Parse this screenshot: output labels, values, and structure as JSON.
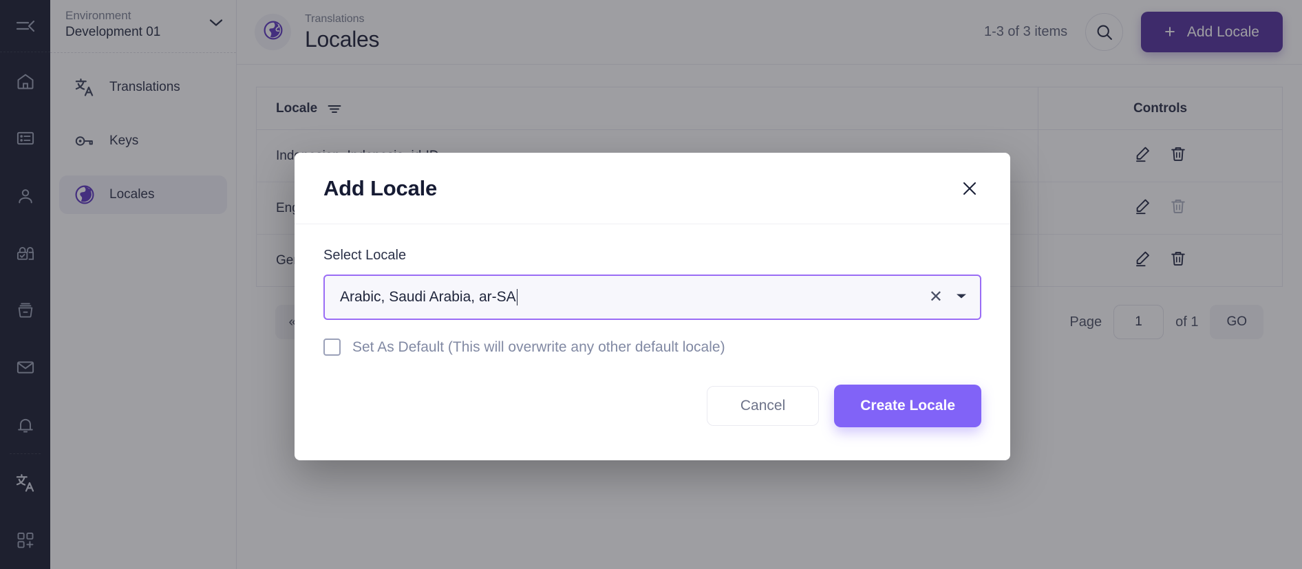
{
  "rail": {
    "collapse_icon": "collapse-menu-icon",
    "items": [
      {
        "icon": "home-icon"
      },
      {
        "icon": "content-list-icon"
      },
      {
        "icon": "user-icon"
      },
      {
        "icon": "security-lock-icon"
      },
      {
        "icon": "archive-icon"
      },
      {
        "icon": "mail-icon"
      },
      {
        "icon": "bell-icon"
      },
      {
        "icon": "translate-icon"
      },
      {
        "icon": "integrations-icon"
      }
    ]
  },
  "sidebar": {
    "env_label": "Environment",
    "env_value": "Development 01",
    "env_caret_icon": "chevron-down-icon",
    "items": [
      {
        "label": "Translations",
        "icon": "translate-icon",
        "active": false
      },
      {
        "label": "Keys",
        "icon": "key-icon",
        "active": false
      },
      {
        "label": "Locales",
        "icon": "globe-icon",
        "active": true
      }
    ]
  },
  "header": {
    "breadcrumb": "Translations",
    "title": "Locales",
    "badge_icon": "globe-icon",
    "items_count": "1-3 of 3 items",
    "search_icon": "search-icon",
    "add_button_label": "Add Locale",
    "add_button_icon": "plus-icon",
    "accent_color": "#512f9b"
  },
  "table": {
    "columns": [
      "Locale",
      "Controls"
    ],
    "filter_icon": "filter-icon",
    "rows": [
      {
        "locale": "Indonesian, Indonesia, id-ID",
        "edit_icon": "pencil-icon",
        "delete_icon": "trash-icon",
        "delete_disabled": false
      },
      {
        "locale": "English, United States, en-US",
        "edit_icon": "pencil-icon",
        "delete_icon": "trash-icon",
        "delete_disabled": true
      },
      {
        "locale": "German, Germany, de-DE",
        "edit_icon": "pencil-icon",
        "delete_icon": "trash-icon",
        "delete_disabled": false
      }
    ]
  },
  "pagination": {
    "first_icon": "double-chevron-left-icon",
    "page_label": "Page",
    "page_value": "1",
    "of_label": "of 1",
    "go_label": "GO"
  },
  "modal": {
    "title": "Add Locale",
    "close_icon": "close-icon",
    "field_label": "Select Locale",
    "select_value": "Arabic, Saudi Arabia, ar-SA",
    "clear_icon": "clear-x-icon",
    "dropdown_icon": "caret-down-icon",
    "checkbox_label": "Set As Default (This will overwrite any other default locale)",
    "checkbox_checked": false,
    "cancel_label": "Cancel",
    "create_label": "Create Locale",
    "primary_color": "#8163f7",
    "focus_border_color": "#9a6cf5"
  }
}
